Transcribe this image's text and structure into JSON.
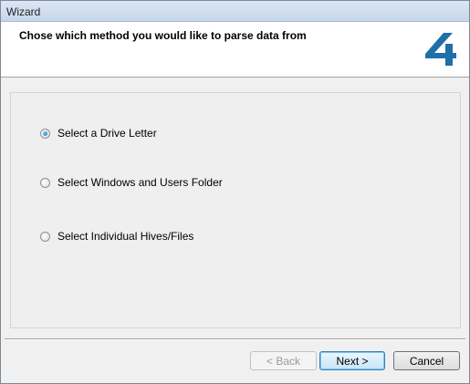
{
  "window": {
    "title": "Wizard"
  },
  "header": {
    "heading": "Chose which method you would like to parse data from",
    "logo_icon": "number-four-logo",
    "logo_color": "#1f6fa8"
  },
  "options": [
    {
      "label": "Select a Drive Letter",
      "checked": true
    },
    {
      "label": "Select Windows and Users Folder",
      "checked": false
    },
    {
      "label": "Select Individual Hives/Files",
      "checked": false
    }
  ],
  "buttons": {
    "back": "< Back",
    "next": "Next >",
    "cancel": "Cancel"
  }
}
